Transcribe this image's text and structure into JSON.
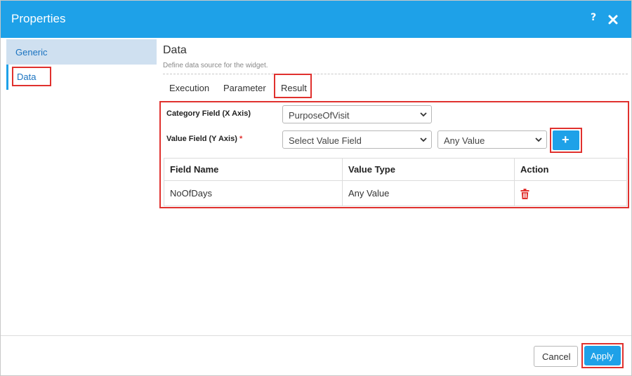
{
  "window": {
    "title": "Properties",
    "help_label": "?"
  },
  "sidebar": {
    "items": [
      {
        "label": "Generic"
      },
      {
        "label": "Data"
      }
    ]
  },
  "section": {
    "title": "Data",
    "description": "Define data source for the widget."
  },
  "tabs": [
    {
      "label": "Execution"
    },
    {
      "label": "Parameter"
    },
    {
      "label": "Result"
    }
  ],
  "result": {
    "category_label": "Category Field (X Axis)",
    "category_value": "PurposeOfVisit",
    "value_label": "Value Field (Y Axis)",
    "required_mark": "*",
    "value_field_value": "Select Value Field",
    "value_type_value": "Any Value",
    "add_label": "+",
    "table": {
      "headers": [
        "Field Name",
        "Value Type",
        "Action"
      ],
      "rows": [
        {
          "field_name": "NoOfDays",
          "value_type": "Any Value"
        }
      ]
    }
  },
  "footer": {
    "cancel_label": "Cancel",
    "apply_label": "Apply"
  },
  "colors": {
    "accent": "#1ea1e8",
    "highlight": "#e0312e",
    "sidebar_active": "#cfe0f0"
  },
  "icons": {
    "close": "close-icon",
    "help": "help-icon",
    "chevron": "chevron-down-icon",
    "delete": "trash-icon",
    "add": "plus-icon"
  }
}
